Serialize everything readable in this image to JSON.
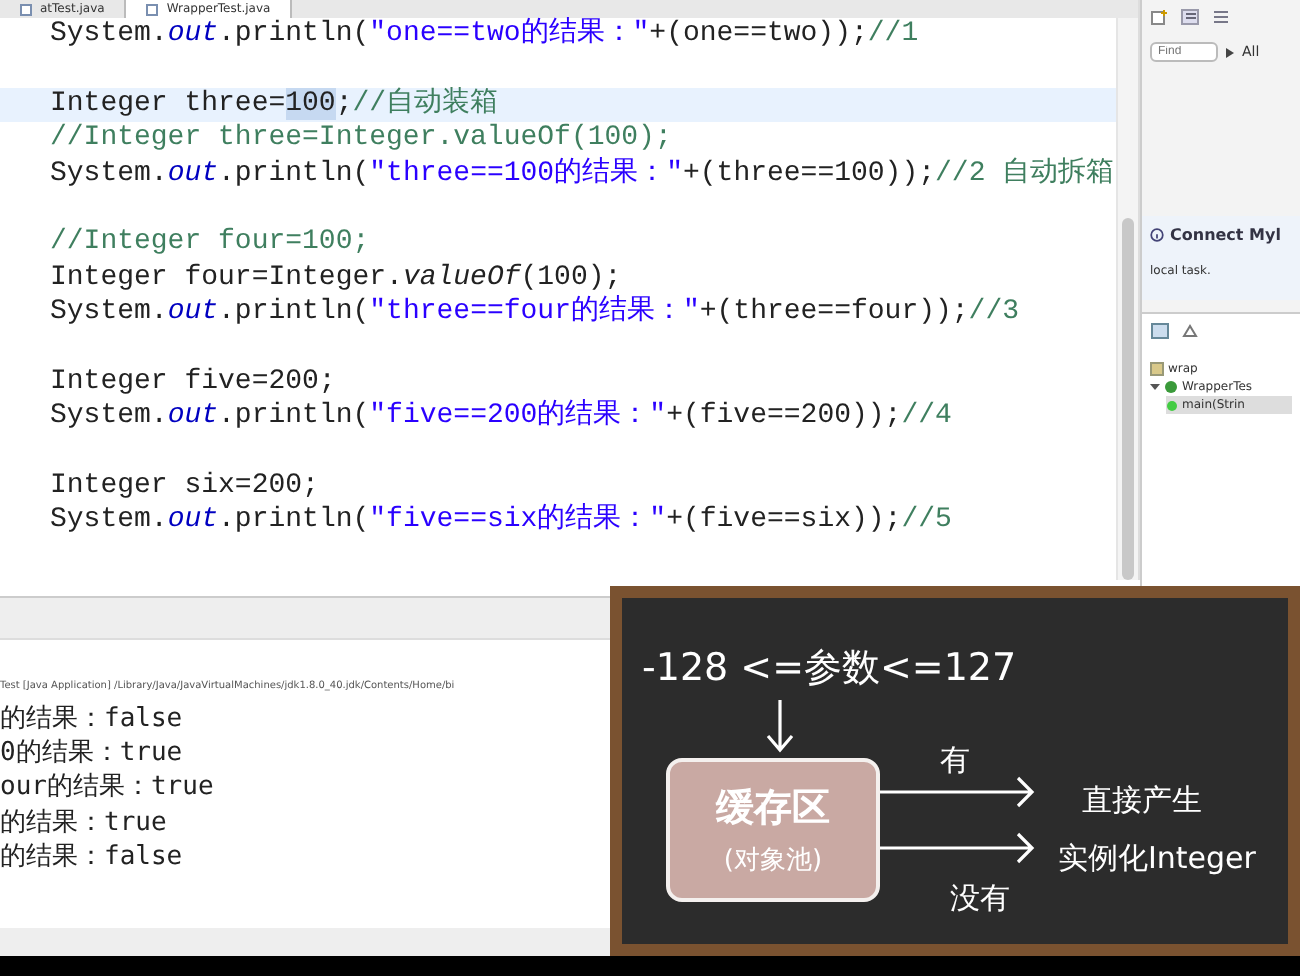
{
  "editor": {
    "tabs": [
      {
        "label": "atTest.java",
        "selected": false
      },
      {
        "label": "WrapperTest.java",
        "selected": true
      }
    ],
    "lines": [
      {
        "kind": "code",
        "current": false,
        "segments": [
          {
            "kind": "plain",
            "text": "System."
          },
          {
            "kind": "field",
            "text": "out"
          },
          {
            "kind": "plain",
            "text": ".println("
          },
          {
            "kind": "string",
            "text": "\"one==two的结果：\""
          },
          {
            "kind": "plain",
            "text": "+(one==two));"
          },
          {
            "kind": "comment",
            "text": "//1"
          }
        ]
      },
      {
        "kind": "blank"
      },
      {
        "kind": "code",
        "current": true,
        "segments": [
          {
            "kind": "plain",
            "text": "Integer three="
          },
          {
            "kind": "selected",
            "text": "100"
          },
          {
            "kind": "plain",
            "text": ";"
          },
          {
            "kind": "comment",
            "text": "//自动装箱"
          }
        ]
      },
      {
        "kind": "code",
        "current": false,
        "segments": [
          {
            "kind": "comment",
            "text": "//Integer three=Integer.valueOf(100);"
          }
        ]
      },
      {
        "kind": "code",
        "current": false,
        "segments": [
          {
            "kind": "plain",
            "text": "System."
          },
          {
            "kind": "field",
            "text": "out"
          },
          {
            "kind": "plain",
            "text": ".println("
          },
          {
            "kind": "string",
            "text": "\"three==100的结果：\""
          },
          {
            "kind": "plain",
            "text": "+(three==100));"
          },
          {
            "kind": "comment",
            "text": "//2 自动拆箱"
          }
        ]
      },
      {
        "kind": "blank"
      },
      {
        "kind": "code",
        "current": false,
        "segments": [
          {
            "kind": "comment",
            "text": "//Integer four=100;"
          }
        ]
      },
      {
        "kind": "code",
        "current": false,
        "segments": [
          {
            "kind": "plain",
            "text": "Integer four=Integer."
          },
          {
            "kind": "method",
            "text": "valueOf"
          },
          {
            "kind": "plain",
            "text": "(100);"
          }
        ]
      },
      {
        "kind": "code",
        "current": false,
        "segments": [
          {
            "kind": "plain",
            "text": "System."
          },
          {
            "kind": "field",
            "text": "out"
          },
          {
            "kind": "plain",
            "text": ".println("
          },
          {
            "kind": "string",
            "text": "\"three==four的结果：\""
          },
          {
            "kind": "plain",
            "text": "+(three==four));"
          },
          {
            "kind": "comment",
            "text": "//3"
          }
        ]
      },
      {
        "kind": "blank"
      },
      {
        "kind": "code",
        "current": false,
        "segments": [
          {
            "kind": "plain",
            "text": "Integer five=200;"
          }
        ]
      },
      {
        "kind": "code",
        "current": false,
        "segments": [
          {
            "kind": "plain",
            "text": "System."
          },
          {
            "kind": "field",
            "text": "out"
          },
          {
            "kind": "plain",
            "text": ".println("
          },
          {
            "kind": "string",
            "text": "\"five==200的结果：\""
          },
          {
            "kind": "plain",
            "text": "+(five==200));"
          },
          {
            "kind": "comment",
            "text": "//4"
          }
        ]
      },
      {
        "kind": "blank"
      },
      {
        "kind": "code",
        "current": false,
        "segments": [
          {
            "kind": "plain",
            "text": "Integer six=200;"
          }
        ]
      },
      {
        "kind": "code",
        "current": false,
        "segments": [
          {
            "kind": "plain",
            "text": "System."
          },
          {
            "kind": "field",
            "text": "out"
          },
          {
            "kind": "plain",
            "text": ".println("
          },
          {
            "kind": "string",
            "text": "\"five==six的结果：\""
          },
          {
            "kind": "plain",
            "text": "+(five==six));"
          },
          {
            "kind": "comment",
            "text": "//5"
          }
        ]
      }
    ]
  },
  "console": {
    "header": "Test [Java Application] /Library/Java/JavaVirtualMachines/jdk1.8.0_40.jdk/Contents/Home/bi",
    "lines": [
      "的结果：false",
      "0的结果：true",
      "our的结果：true",
      "的结果：true",
      "的结果：false"
    ]
  },
  "task_list": {
    "find_placeholder": "Find",
    "all_label": "All"
  },
  "connect_panel": {
    "title": "Connect Myl",
    "text": "local task."
  },
  "outline": {
    "items": [
      {
        "label": "wrap",
        "kind": "package"
      },
      {
        "label": "WrapperTes",
        "kind": "class",
        "expanded": true,
        "children": [
          {
            "label": "main(Strin",
            "kind": "method",
            "selected": true
          }
        ]
      }
    ]
  },
  "blackboard": {
    "condition": "-128 <=参数<=127",
    "cache_title": "缓存区",
    "cache_subtitle": "(对象池)",
    "yes_label": "有",
    "yes_result": "直接产生",
    "no_label": "没有",
    "no_result": "实例化Integer"
  }
}
